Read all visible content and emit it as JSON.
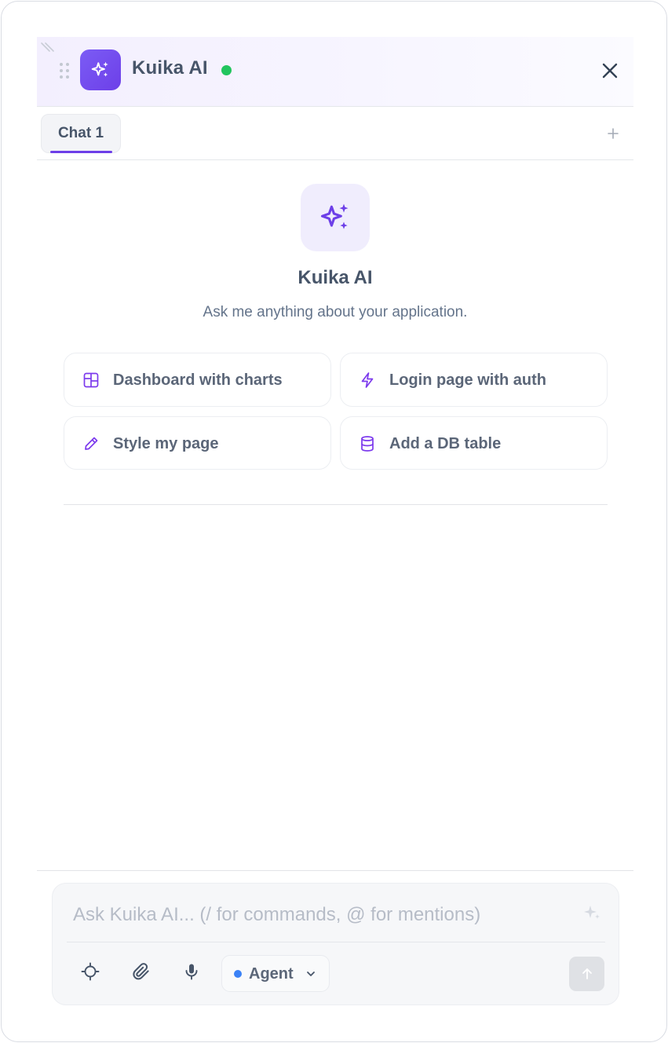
{
  "header": {
    "title": "Kuika AI",
    "status": "online",
    "status_color": "#22c55e",
    "brand_color": "#6d3fe8",
    "icons": {
      "logo": "sparkles-icon",
      "close": "close-icon",
      "drag": "drag-handle-icon"
    }
  },
  "tabs": [
    {
      "label": "Chat 1",
      "active": true
    }
  ],
  "welcome": {
    "title": "Kuika AI",
    "subtitle": "Ask me anything about your application.",
    "suggestions": [
      {
        "label": "Dashboard with charts",
        "icon": "layout-icon"
      },
      {
        "label": "Login page with auth",
        "icon": "lightning-icon"
      },
      {
        "label": "Style my page",
        "icon": "pipette-icon"
      },
      {
        "label": "Add a DB table",
        "icon": "database-icon"
      }
    ]
  },
  "composer": {
    "placeholder": "Ask Kuika AI... (/ for commands, @ for mentions)",
    "value": "",
    "mode": {
      "selected": "Agent",
      "dot_color": "#3b82f6"
    },
    "icons": [
      "crosshair-icon",
      "paperclip-icon",
      "microphone-icon",
      "send-arrow-icon",
      "sparkle-enhance-icon"
    ]
  }
}
